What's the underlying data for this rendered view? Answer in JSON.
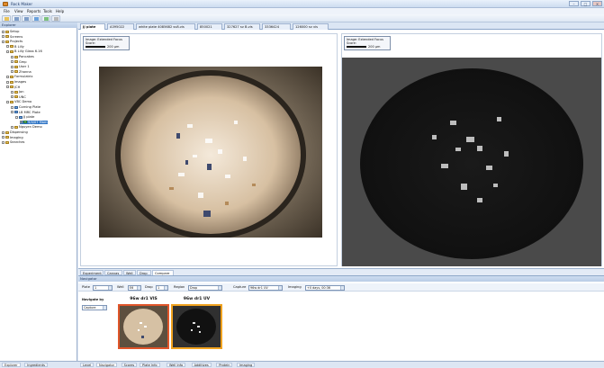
{
  "window": {
    "title": "Rock Maker"
  },
  "menu": [
    "File",
    "View",
    "Reports",
    "Tools",
    "Help"
  ],
  "explorer": {
    "header": "Explorer",
    "tree": [
      {
        "label": "Setup",
        "icon": "folder",
        "level": 0
      },
      {
        "label": "Screens",
        "icon": "folder",
        "level": 0
      },
      {
        "label": "Projects",
        "icon": "folder",
        "level": 0
      },
      {
        "label": "B Lilly",
        "icon": "folder",
        "level": 1
      },
      {
        "label": "B Lilly Glass 6.16",
        "icon": "folder",
        "level": 1
      },
      {
        "label": "Pancakes",
        "icon": "folder",
        "level": 2
      },
      {
        "label": "Gmp",
        "icon": "folder",
        "level": 2
      },
      {
        "label": "User 1",
        "icon": "folder",
        "level": 2
      },
      {
        "label": "Zhanna",
        "icon": "folder",
        "level": 2
      },
      {
        "label": "Formulatrix",
        "icon": "folder",
        "level": 1
      },
      {
        "label": "Images",
        "icon": "folder",
        "level": 1
      },
      {
        "label": "JCH",
        "icon": "folder",
        "level": 1
      },
      {
        "label": "Jon",
        "icon": "folder",
        "level": 2
      },
      {
        "label": "UNC",
        "icon": "folder",
        "level": 2
      },
      {
        "label": "VBC Demo",
        "icon": "folder",
        "level": 1
      },
      {
        "label": "Corning Plate",
        "icon": "plate",
        "level": 2
      },
      {
        "label": "LB MRC Plate",
        "icon": "plate",
        "level": 2
      },
      {
        "label": "JJ plate",
        "icon": "plate",
        "level": 3
      },
      {
        "label": "9/4/07 Mam",
        "icon": "img",
        "level": 4,
        "selected": true
      },
      {
        "label": "Nguyen Demo",
        "icon": "folder",
        "level": 2
      },
      {
        "label": "Dispensing",
        "icon": "folder",
        "level": 0
      },
      {
        "label": "Imaging",
        "icon": "folder",
        "level": 0
      },
      {
        "label": "Searches",
        "icon": "folder",
        "level": 0
      }
    ]
  },
  "doc_tabs": [
    "JJ plate",
    "A395022",
    "white plate 4085682 sv8.vis",
    "850021",
    "327627 sv B.vis",
    "3336424",
    "126000 sv vis"
  ],
  "compare": {
    "left_caption": {
      "line1": "Image: Extended Focus",
      "line2": "Score:",
      "scale": "200 µm"
    },
    "right_caption": {
      "line1": "Image: Extended Focus",
      "line2": "Score:",
      "scale": "200 µm"
    }
  },
  "bottom_tabs": [
    "Experiment",
    "Canvas",
    "Well",
    "Drop",
    "Compare"
  ],
  "navigator": {
    "header": "Navigator",
    "plate_label": "Plate",
    "plate_value": "1",
    "well_label": "Well",
    "well_value": "E6",
    "drop_label": "Drop",
    "drop_value": "1",
    "region_label": "Region",
    "region_value": "Drop",
    "capture_label": "Capture",
    "capture_value": "96w dr1 UV",
    "imaging_label": "Imaging",
    "imaging_value": "+0 days, 00:36",
    "navigate_by_label": "Navigate by",
    "navigate_by_value": "Capture",
    "thumbs": [
      {
        "title": "96w dr1 VIS",
        "border": "#e0552a"
      },
      {
        "title": "96w dr1 UV",
        "border": "#f0a21f"
      }
    ]
  },
  "status_tabs_left": [
    "Explorer",
    "Ingredients"
  ],
  "status_tabs_right": [
    "Level",
    "Navigator",
    "Scores",
    "Plate Info",
    "Well Info",
    "Additives",
    "Protein",
    "Imaging"
  ]
}
